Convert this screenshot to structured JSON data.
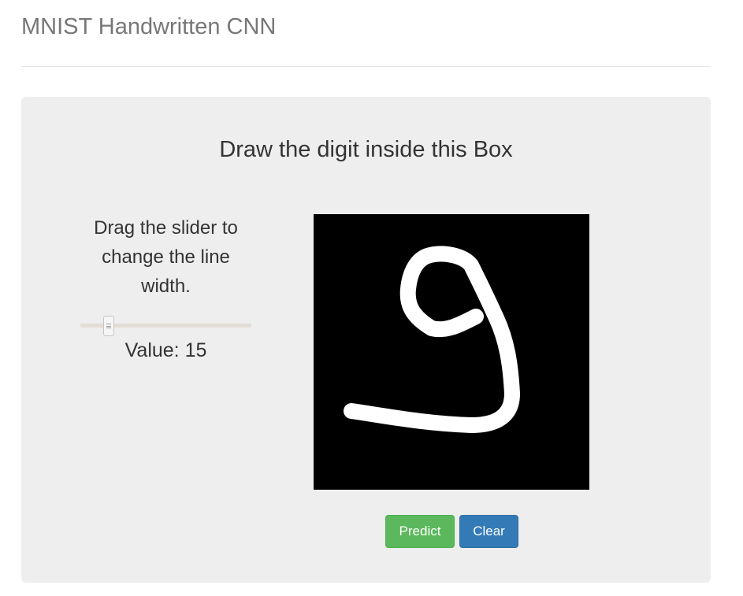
{
  "header": {
    "title": "MNIST Handwritten CNN"
  },
  "panel": {
    "heading": "Draw the digit inside this Box",
    "instructions": "Drag the slider to change the line width.",
    "value_label": "Value:",
    "line_width": 15,
    "slider": {
      "min": 1,
      "max": 100,
      "value": 15
    }
  },
  "canvas": {
    "background": "#000000",
    "stroke_color": "#ffffff",
    "drawn_digit": "9"
  },
  "buttons": {
    "predict_label": "Predict",
    "clear_label": "Clear"
  },
  "colors": {
    "predict": "#5cb85c",
    "clear": "#337ab7",
    "panel_bg": "#eeeeee",
    "title": "#777777"
  }
}
